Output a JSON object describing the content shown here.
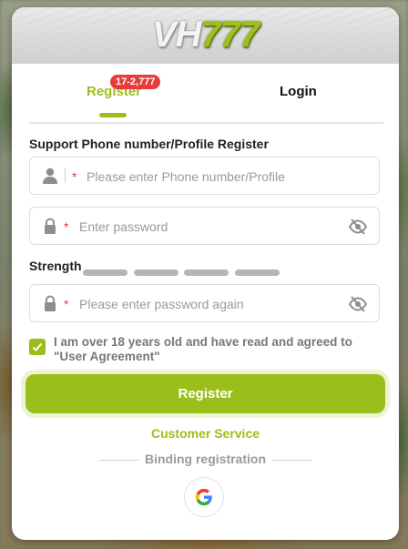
{
  "banner": {
    "logo_letters": "VH",
    "logo_digits": "777"
  },
  "tabs": {
    "register_label": "Register",
    "register_badge": "17-2,777",
    "login_label": "Login",
    "active": "Register"
  },
  "form": {
    "account_label": "Support Phone number/Profile Register",
    "account_placeholder": "Please enter Phone number/Profile",
    "password_placeholder": "Enter password",
    "strength_label": "Strength",
    "confirm_placeholder": "Please enter password again",
    "required_mark": "*",
    "agree_checked": true,
    "agree_text": "I am over 18 years old and have read and agreed to \"User Agreement\"",
    "submit_label": "Register"
  },
  "footer": {
    "customer_service": "Customer Service",
    "binding_label": "Binding registration"
  },
  "icons": {
    "user": "user-icon",
    "lock": "lock-icon",
    "eye_off": "eye-off-icon",
    "check": "check-icon",
    "google": "google-icon"
  },
  "colors": {
    "accent": "#9bbf1a",
    "badge": "#e93b3b",
    "required": "#e93b3b"
  }
}
